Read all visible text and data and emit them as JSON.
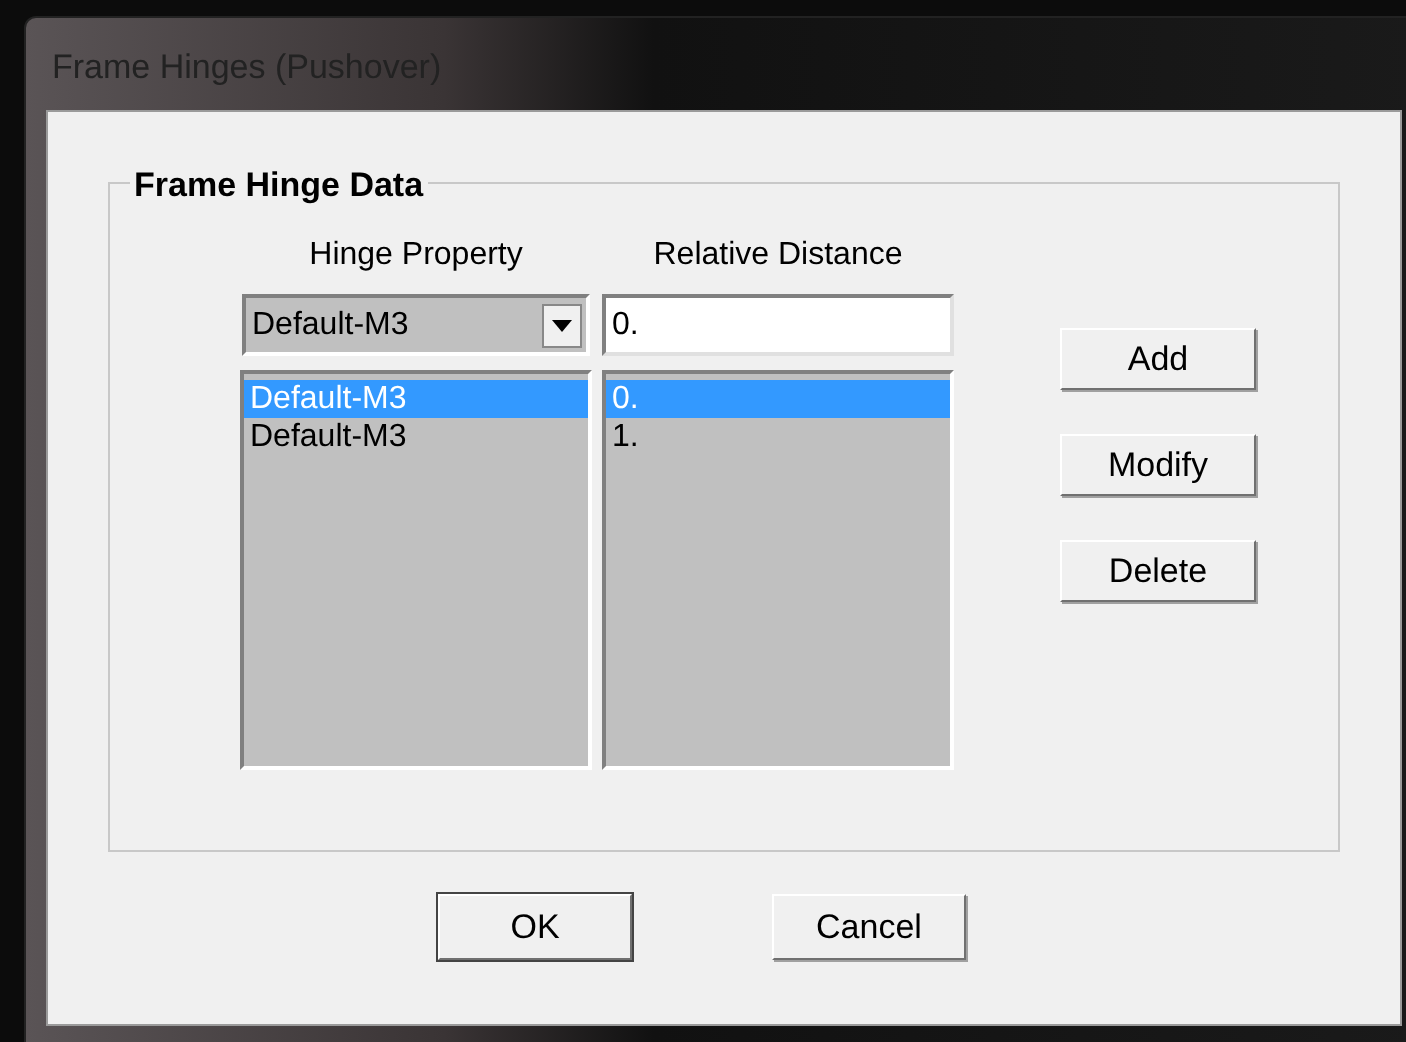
{
  "window": {
    "title": "Frame Hinges (Pushover)"
  },
  "group": {
    "title": "Frame Hinge Data"
  },
  "columns": [
    {
      "heading": "Hinge Property"
    },
    {
      "heading": "Relative Distance"
    }
  ],
  "hinge_property": {
    "value": "Default-M3"
  },
  "relative_distance": {
    "value": "0."
  },
  "hinge_list": [
    {
      "text": "Default-M3",
      "selected": true
    },
    {
      "text": "Default-M3",
      "selected": false
    }
  ],
  "distance_list": [
    {
      "text": "0.",
      "selected": true
    },
    {
      "text": "1.",
      "selected": false
    }
  ],
  "side_buttons": [
    "Add",
    "Modify",
    "Delete"
  ],
  "buttons": [
    {
      "label": "OK",
      "default": true
    },
    {
      "label": "Cancel",
      "default": false
    }
  ]
}
